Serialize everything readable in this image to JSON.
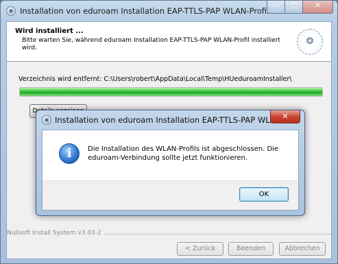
{
  "window": {
    "title": "Installation von eduroam Installation EAP-TTLS-PAP WLAN-Profil",
    "minimize_glyph": "—",
    "maximize_glyph": "□",
    "close_glyph": "✕"
  },
  "header": {
    "title": "Wird installiert ...",
    "subtitle": "Bitte warten Sie, während eduroam Installation EAP-TTLS-PAP WLAN-Profil installiert wird."
  },
  "status_text": "Verzeichnis wird entfernt: C:\\Users\\robert\\AppData\\Local\\Temp\\HUeduroamInstaller\\",
  "progress": {
    "percent": 100,
    "color": "#22a522"
  },
  "details_button": "Details anzeigen",
  "footer": {
    "branding": "Nullsoft Install System v3.03-2",
    "back_button": "< Zurück",
    "finish_button": "Beenden",
    "cancel_button": "Abbrechen"
  },
  "dialog": {
    "title": "Installation von eduroam Installation EAP-TTLS-PAP WLAN-...",
    "close_glyph": "✕",
    "icon_glyph": "i",
    "message": "Die Installation des WLAN-Profils ist abgeschlossen. Die eduroam-Verbindung sollte jetzt funktionieren.",
    "ok_button": "OK"
  },
  "icons": {
    "app": "eduroam-app-icon",
    "info": "info-icon",
    "seal": "university-seal-icon"
  }
}
